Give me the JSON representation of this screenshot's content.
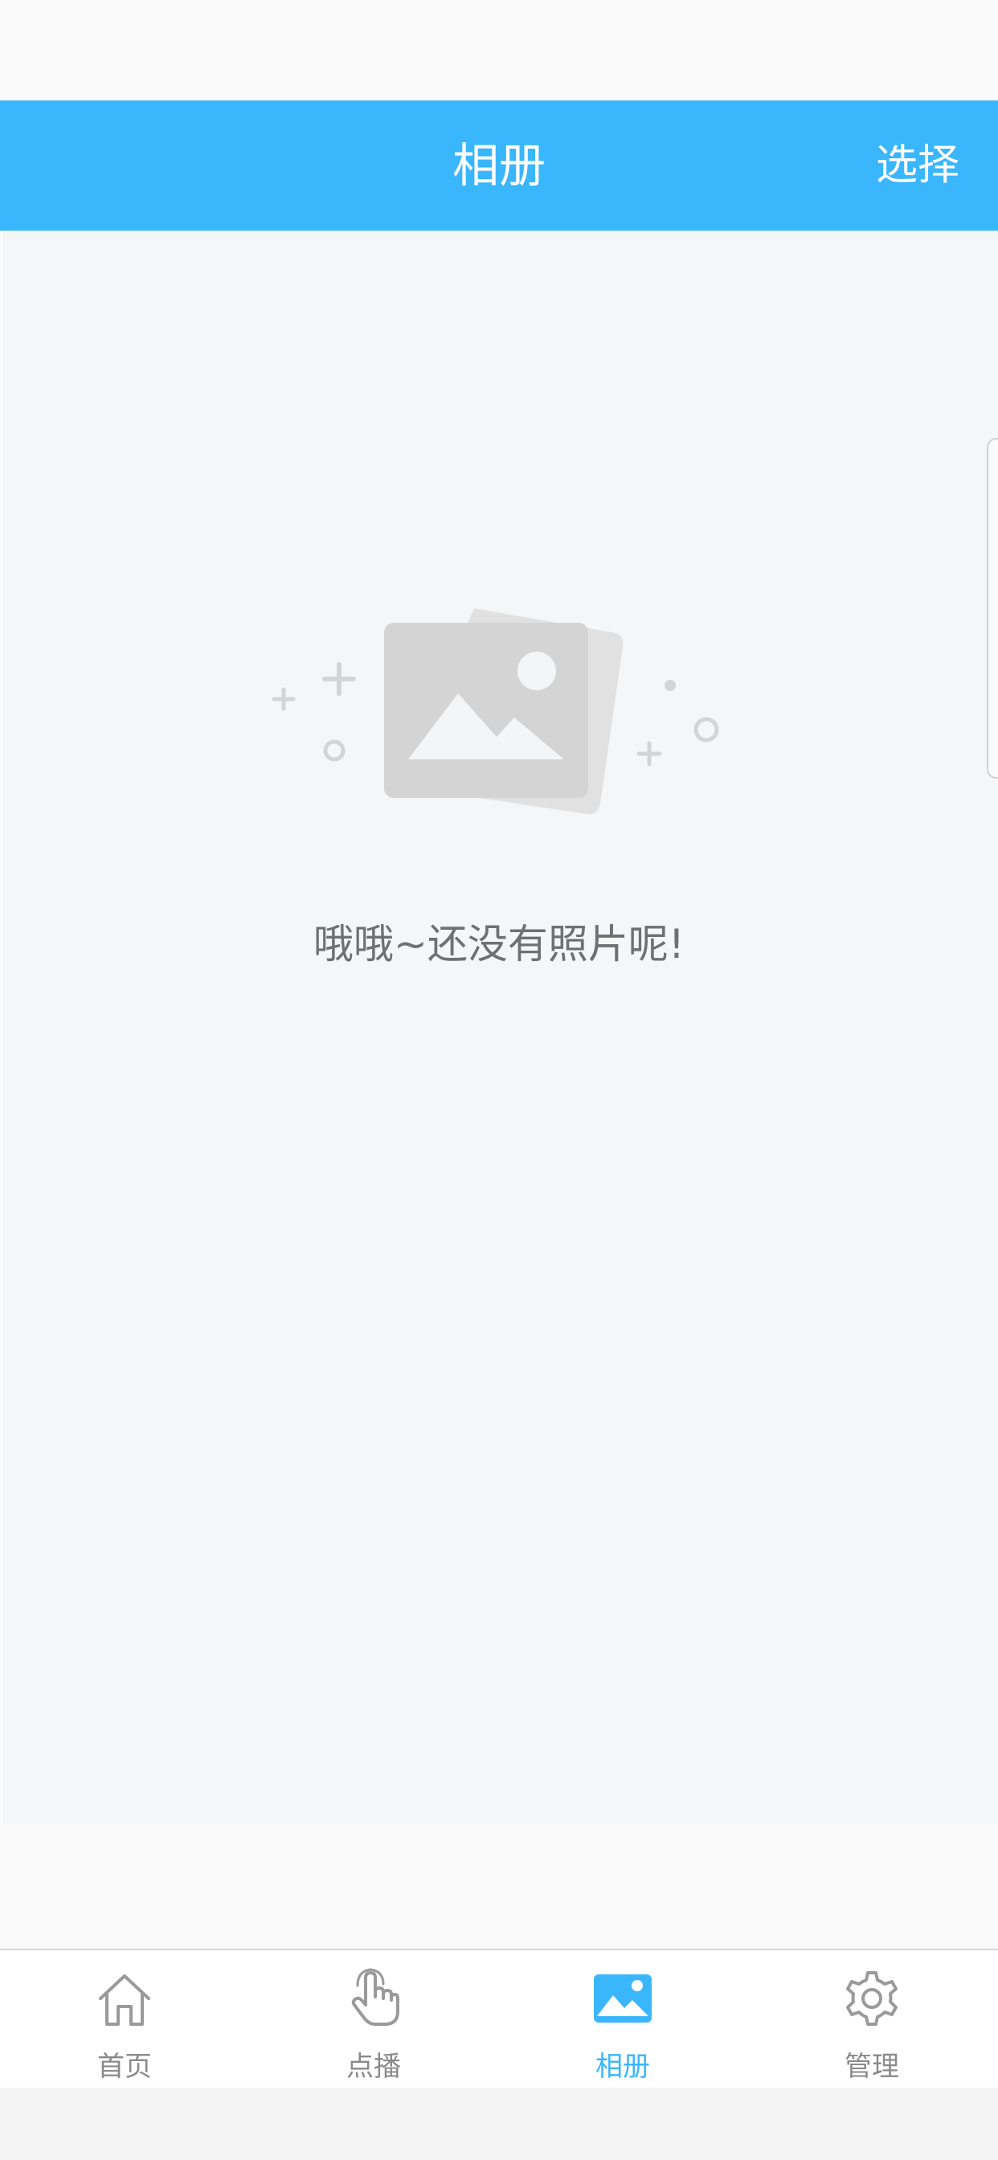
{
  "header": {
    "title": "相册",
    "action_label": "选择"
  },
  "empty_state": {
    "message": "哦哦~还没有照片呢!"
  },
  "tabs": [
    {
      "label": "首页",
      "icon": "home-icon",
      "active": false
    },
    {
      "label": "点播",
      "icon": "touch-hand-icon",
      "active": false
    },
    {
      "label": "相册",
      "icon": "photo-icon",
      "active": true
    },
    {
      "label": "管理",
      "icon": "gear-icon",
      "active": false
    }
  ],
  "colors": {
    "accent": "#3ab6fd",
    "tab_inactive": "#8a8a8a",
    "empty_text": "#707070",
    "illustration": "#d4d4d4"
  }
}
